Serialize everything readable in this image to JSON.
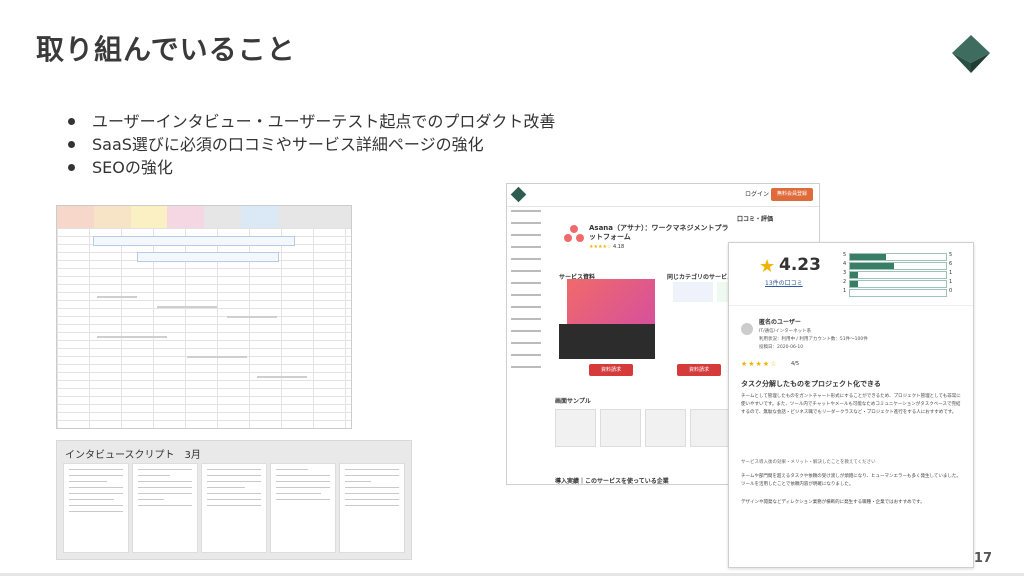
{
  "slide": {
    "title": "取り組んでいること",
    "page_number": "17",
    "accent_color": "#2e5c4e"
  },
  "bullets": [
    "ユーザーインタビュー・ユーザーテスト起点でのプロダクト改善",
    "SaaS選びに必須の口コミやサービス詳細ページの強化",
    "SEOの強化"
  ],
  "script_panel": {
    "title": "インタビュースクリプト　3月"
  },
  "service_page": {
    "login": "ログイン",
    "cta": "無料会員登録",
    "product_name": "Asana（アサナ）：ワークマネジメントプラットフォーム",
    "reviews_section": "口コミ・評価",
    "rating": "4.18",
    "section_features": "サービス資料",
    "section_other": "同じカテゴリのサービス",
    "section_screens": "画面サンプル",
    "section_cases": "導入実績｜このサービスを使っている企業",
    "button_download": "資料請求"
  },
  "review_card": {
    "rating": "4.23",
    "review_count_link": "13件の口コミ",
    "distribution": [
      {
        "star": "5",
        "count": "5",
        "fraction": 0.38
      },
      {
        "star": "4",
        "count": "6",
        "fraction": 0.46
      },
      {
        "star": "3",
        "count": "1",
        "fraction": 0.08
      },
      {
        "star": "2",
        "count": "1",
        "fraction": 0.08
      },
      {
        "star": "1",
        "count": "0",
        "fraction": 0.0
      }
    ],
    "user_name": "匿名のユーザー",
    "user_industry": "IT/通信/インターネット系",
    "user_status": "利用状況：利用中 / 利用アカウント数：51件〜100件",
    "user_date": "投稿日：2020-06-10",
    "user_score": "4/5",
    "review_title": "タスク分解したものをプロジェクト化できる",
    "review_body": "チームとして管理したものをガントチャート形式にすることができるため、プロジェクト管理としても非常に使いやすいです。また、ツール内でチャットやメールも可能なためコミュニケーションがタスクベースで完結するので、無駄な会話・ビジネス職でもリーダークラスなど・プロジェクト進行をする人におすすめです。",
    "review_section": "サービス導入後の効果・メリット・解決したことを教えてください",
    "review_body2": "チームや部門間を超えるタスクや依頼の受け渡しが煩雑になり、ヒューマンエラーも多く発生していました。ツールを活用したことで依頼内容が明確になりました。",
    "review_body3": "デザインや開発などディレクション業務が横断的に発生する職種・企業ではおすすめです。"
  }
}
